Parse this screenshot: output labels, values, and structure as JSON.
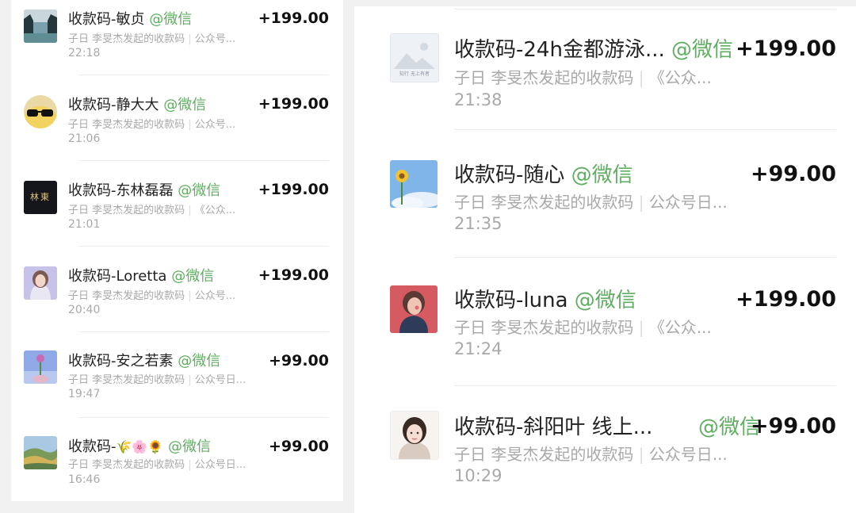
{
  "left_list": [
    {
      "title": "收款码-敏贞",
      "tag": "@微信",
      "from": "子日 李旻杰发起的收款码",
      "note": "公众号...",
      "time": "22:18",
      "amount": "+199.00"
    },
    {
      "title": "收款码-静大大",
      "tag": "@微信",
      "from": "子日 李旻杰发起的收款码",
      "note": "公众号...",
      "time": "21:06",
      "amount": "+199.00"
    },
    {
      "title": "收款码-东林磊磊",
      "tag": "@微信",
      "from": "子日 李旻杰发起的收款码",
      "note": "《公众...",
      "time": "21:01",
      "amount": "+199.00"
    },
    {
      "title": "收款码-Loretta",
      "tag": "@微信",
      "from": "子日 李旻杰发起的收款码",
      "note": "公众号...",
      "time": "20:40",
      "amount": "+199.00"
    },
    {
      "title": "收款码-安之若素",
      "tag": "@微信",
      "from": "子日 李旻杰发起的收款码",
      "note": "公众号日...",
      "time": "19:47",
      "amount": "+99.00"
    },
    {
      "title": "收款码-",
      "title_emoji": "🌾🌸🌻",
      "tag": "@微信",
      "from": "子日 李旻杰发起的收款码",
      "note": "公众号日...",
      "time": "16:46",
      "amount": "+99.00"
    }
  ],
  "right_list": [
    {
      "title": "收款码-24h金都游泳...",
      "tag": "@微信",
      "from": "子日 李旻杰发起的收款码",
      "note": "《公众...",
      "time": "21:38",
      "amount": "+199.00"
    },
    {
      "title": "收款码-随心",
      "tag": "@微信",
      "from": "子日 李旻杰发起的收款码",
      "note": "公众号日...",
      "time": "21:35",
      "amount": "+99.00"
    },
    {
      "title": "收款码-luna",
      "tag": "@微信",
      "from": "子日 李旻杰发起的收款码",
      "note": "《公众...",
      "time": "21:24",
      "amount": "+199.00"
    },
    {
      "title": "收款码-斜阳叶 线上...",
      "tag": "@微信",
      "from": "子日 李旻杰发起的收款码",
      "note": "公众号日...",
      "time": "10:29",
      "amount": "+99.00"
    }
  ],
  "avatar_text": {
    "dong_lin": "林東",
    "placeholder": "知行 无上有者"
  },
  "colors": {
    "wechat_tag": "#5fae61",
    "amount": "#111111",
    "secondary_text": "#a9a9a9",
    "background": "#f1f1f1"
  }
}
